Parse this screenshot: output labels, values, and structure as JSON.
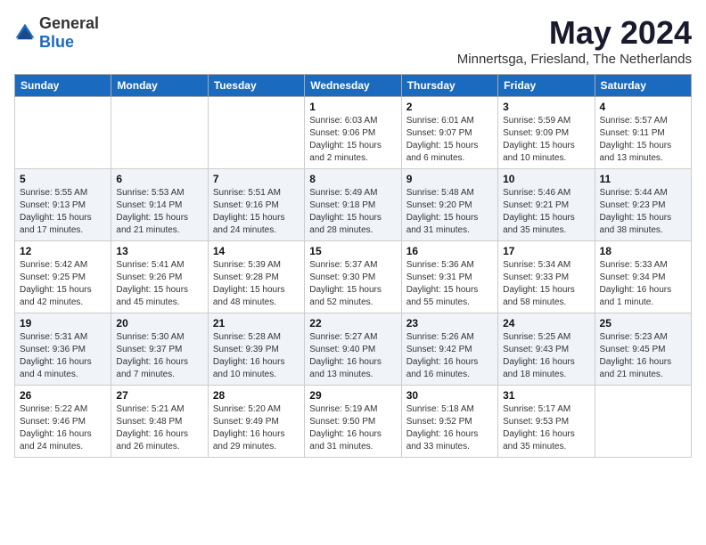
{
  "logo": {
    "text_general": "General",
    "text_blue": "Blue"
  },
  "calendar": {
    "title": "May 2024",
    "subtitle": "Minnertsga, Friesland, The Netherlands",
    "days_of_week": [
      "Sunday",
      "Monday",
      "Tuesday",
      "Wednesday",
      "Thursday",
      "Friday",
      "Saturday"
    ],
    "weeks": [
      [
        {
          "date": "",
          "info": ""
        },
        {
          "date": "",
          "info": ""
        },
        {
          "date": "",
          "info": ""
        },
        {
          "date": "1",
          "info": "Sunrise: 6:03 AM\nSunset: 9:06 PM\nDaylight: 15 hours and 2 minutes."
        },
        {
          "date": "2",
          "info": "Sunrise: 6:01 AM\nSunset: 9:07 PM\nDaylight: 15 hours and 6 minutes."
        },
        {
          "date": "3",
          "info": "Sunrise: 5:59 AM\nSunset: 9:09 PM\nDaylight: 15 hours and 10 minutes."
        },
        {
          "date": "4",
          "info": "Sunrise: 5:57 AM\nSunset: 9:11 PM\nDaylight: 15 hours and 13 minutes."
        }
      ],
      [
        {
          "date": "5",
          "info": "Sunrise: 5:55 AM\nSunset: 9:13 PM\nDaylight: 15 hours and 17 minutes."
        },
        {
          "date": "6",
          "info": "Sunrise: 5:53 AM\nSunset: 9:14 PM\nDaylight: 15 hours and 21 minutes."
        },
        {
          "date": "7",
          "info": "Sunrise: 5:51 AM\nSunset: 9:16 PM\nDaylight: 15 hours and 24 minutes."
        },
        {
          "date": "8",
          "info": "Sunrise: 5:49 AM\nSunset: 9:18 PM\nDaylight: 15 hours and 28 minutes."
        },
        {
          "date": "9",
          "info": "Sunrise: 5:48 AM\nSunset: 9:20 PM\nDaylight: 15 hours and 31 minutes."
        },
        {
          "date": "10",
          "info": "Sunrise: 5:46 AM\nSunset: 9:21 PM\nDaylight: 15 hours and 35 minutes."
        },
        {
          "date": "11",
          "info": "Sunrise: 5:44 AM\nSunset: 9:23 PM\nDaylight: 15 hours and 38 minutes."
        }
      ],
      [
        {
          "date": "12",
          "info": "Sunrise: 5:42 AM\nSunset: 9:25 PM\nDaylight: 15 hours and 42 minutes."
        },
        {
          "date": "13",
          "info": "Sunrise: 5:41 AM\nSunset: 9:26 PM\nDaylight: 15 hours and 45 minutes."
        },
        {
          "date": "14",
          "info": "Sunrise: 5:39 AM\nSunset: 9:28 PM\nDaylight: 15 hours and 48 minutes."
        },
        {
          "date": "15",
          "info": "Sunrise: 5:37 AM\nSunset: 9:30 PM\nDaylight: 15 hours and 52 minutes."
        },
        {
          "date": "16",
          "info": "Sunrise: 5:36 AM\nSunset: 9:31 PM\nDaylight: 15 hours and 55 minutes."
        },
        {
          "date": "17",
          "info": "Sunrise: 5:34 AM\nSunset: 9:33 PM\nDaylight: 15 hours and 58 minutes."
        },
        {
          "date": "18",
          "info": "Sunrise: 5:33 AM\nSunset: 9:34 PM\nDaylight: 16 hours and 1 minute."
        }
      ],
      [
        {
          "date": "19",
          "info": "Sunrise: 5:31 AM\nSunset: 9:36 PM\nDaylight: 16 hours and 4 minutes."
        },
        {
          "date": "20",
          "info": "Sunrise: 5:30 AM\nSunset: 9:37 PM\nDaylight: 16 hours and 7 minutes."
        },
        {
          "date": "21",
          "info": "Sunrise: 5:28 AM\nSunset: 9:39 PM\nDaylight: 16 hours and 10 minutes."
        },
        {
          "date": "22",
          "info": "Sunrise: 5:27 AM\nSunset: 9:40 PM\nDaylight: 16 hours and 13 minutes."
        },
        {
          "date": "23",
          "info": "Sunrise: 5:26 AM\nSunset: 9:42 PM\nDaylight: 16 hours and 16 minutes."
        },
        {
          "date": "24",
          "info": "Sunrise: 5:25 AM\nSunset: 9:43 PM\nDaylight: 16 hours and 18 minutes."
        },
        {
          "date": "25",
          "info": "Sunrise: 5:23 AM\nSunset: 9:45 PM\nDaylight: 16 hours and 21 minutes."
        }
      ],
      [
        {
          "date": "26",
          "info": "Sunrise: 5:22 AM\nSunset: 9:46 PM\nDaylight: 16 hours and 24 minutes."
        },
        {
          "date": "27",
          "info": "Sunrise: 5:21 AM\nSunset: 9:48 PM\nDaylight: 16 hours and 26 minutes."
        },
        {
          "date": "28",
          "info": "Sunrise: 5:20 AM\nSunset: 9:49 PM\nDaylight: 16 hours and 29 minutes."
        },
        {
          "date": "29",
          "info": "Sunrise: 5:19 AM\nSunset: 9:50 PM\nDaylight: 16 hours and 31 minutes."
        },
        {
          "date": "30",
          "info": "Sunrise: 5:18 AM\nSunset: 9:52 PM\nDaylight: 16 hours and 33 minutes."
        },
        {
          "date": "31",
          "info": "Sunrise: 5:17 AM\nSunset: 9:53 PM\nDaylight: 16 hours and 35 minutes."
        },
        {
          "date": "",
          "info": ""
        }
      ]
    ]
  }
}
